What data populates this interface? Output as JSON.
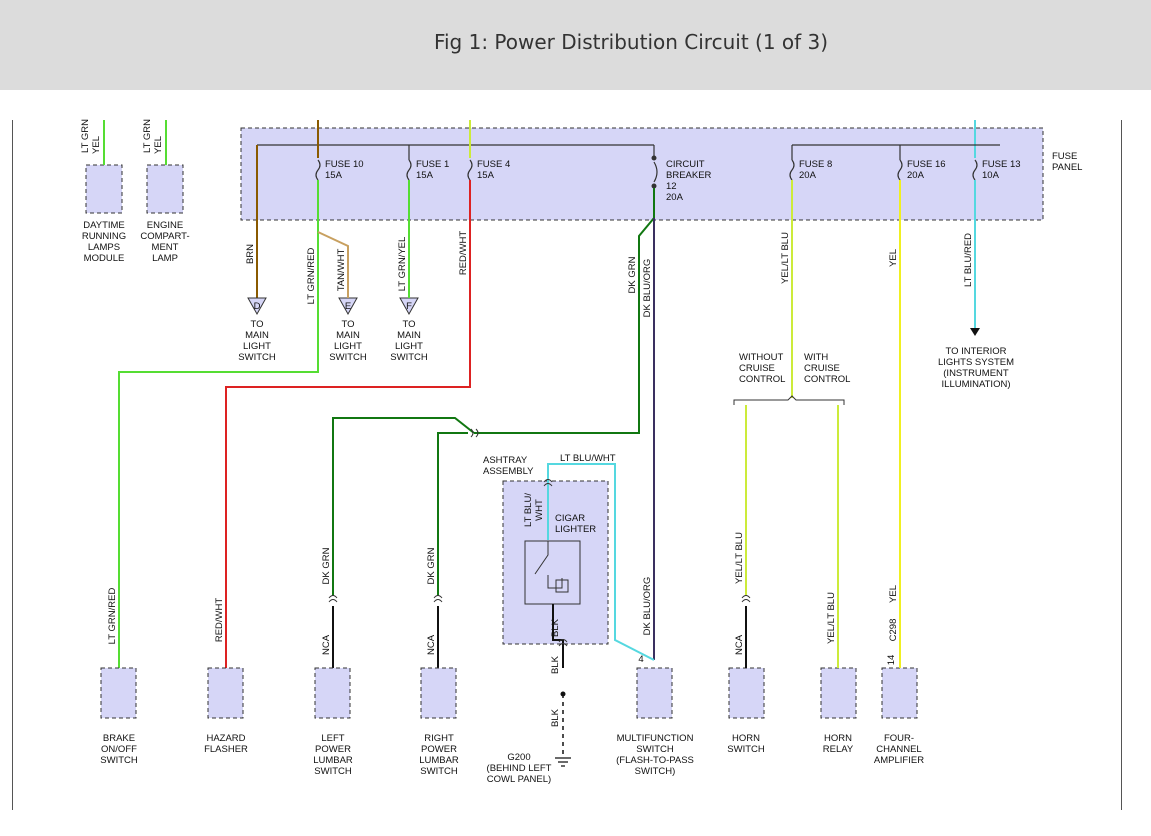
{
  "title": "Fig 1: Power Distribution Circuit (1 of 3)",
  "colors": {
    "header_bg": "#dcdcdc",
    "panel_fill": "#d6d6f7",
    "brown": "#8a5a00",
    "lt_grn": "#55dd33",
    "tan": "#c8a060",
    "red": "#dd2222",
    "dk_grn": "#117711",
    "lt_blu": "#55d8e0",
    "yel_lt_blu": "#cceb3a",
    "yel": "#f0f020",
    "dk_blu_org": "#3a3060",
    "black": "#111111"
  },
  "labels": {
    "fuse_panel": [
      "FUSE",
      "PANEL"
    ],
    "fuse10": [
      "FUSE 10",
      "15A"
    ],
    "fuse1": [
      "FUSE 1",
      "15A"
    ],
    "fuse4": [
      "FUSE 4",
      "15A"
    ],
    "breaker": [
      "CIRCUIT",
      "BREAKER",
      "12",
      "20A"
    ],
    "fuse8": [
      "FUSE 8",
      "20A"
    ],
    "fuse16": [
      "FUSE 16",
      "20A"
    ],
    "fuse13": [
      "FUSE 13",
      "10A"
    ],
    "drl_module": [
      "DAYTIME",
      "RUNNING",
      "LAMPS",
      "MODULE"
    ],
    "engine_lamp": [
      "ENGINE",
      "COMPART-",
      "MENT",
      "LAMP"
    ],
    "to_main_d": [
      "TO",
      "MAIN",
      "LIGHT",
      "SWITCH"
    ],
    "to_main_e": [
      "TO",
      "MAIN",
      "LIGHT",
      "SWITCH"
    ],
    "to_main_f": [
      "TO",
      "MAIN",
      "LIGHT",
      "SWITCH"
    ],
    "conn_d": "D",
    "conn_e": "E",
    "conn_f": "F",
    "without_cruise": [
      "WITHOUT",
      "CRUISE",
      "CONTROL"
    ],
    "with_cruise": [
      "WITH",
      "CRUISE",
      "CONTROL"
    ],
    "to_interior": [
      "TO INTERIOR",
      "LIGHTS SYSTEM",
      "(INSTRUMENT",
      "ILLUMINATION)"
    ],
    "ashtray": [
      "ASHTRAY",
      "ASSEMBLY"
    ],
    "cigar": [
      "CIGAR",
      "LIGHTER"
    ],
    "brake": [
      "BRAKE",
      "ON/OFF",
      "SWITCH"
    ],
    "hazard": [
      "HAZARD",
      "FLASHER"
    ],
    "left_lumbar": [
      "LEFT",
      "POWER",
      "LUMBAR",
      "SWITCH"
    ],
    "right_lumbar": [
      "RIGHT",
      "POWER",
      "LUMBAR",
      "SWITCH"
    ],
    "g200": [
      "G200",
      "(BEHIND LEFT",
      "COWL PANEL)"
    ],
    "multifunction": [
      "MULTIFUNCTION",
      "SWITCH",
      "(FLASH-TO-PASS",
      "SWITCH)"
    ],
    "horn_switch": [
      "HORN",
      "SWITCH"
    ],
    "horn_relay": [
      "HORN",
      "RELAY"
    ],
    "amplifier": [
      "FOUR-",
      "CHANNEL",
      "AMPLIFIER"
    ],
    "pin4": "4",
    "pin14": "14"
  },
  "wires": {
    "lt_grn_top": "LT GRN",
    "yel_top": "YEL",
    "brn": "BRN",
    "lt_grn_red": "LT GRN/RED",
    "tan_wht": "TAN/WHT",
    "lt_grn_yel": "LT GRN/YEL",
    "red_wht": "RED/WHT",
    "dk_grn": "DK GRN",
    "dk_blu_org": "DK BLU/ORG",
    "yel_lt_blu": "YEL/LT BLU",
    "yel": "YEL",
    "lt_blu_red": "LT BLU/RED",
    "lt_blu_wht": "LT BLU/WHT",
    "lt_blu_wht_split": [
      "LT BLU/",
      "WHT"
    ],
    "blk": "BLK",
    "nca": "NCA",
    "c298": "C298"
  }
}
